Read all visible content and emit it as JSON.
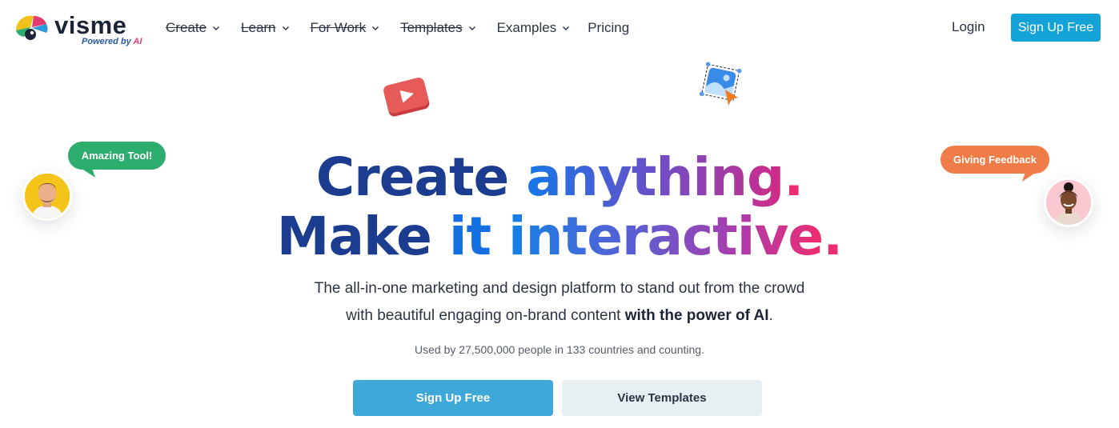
{
  "brand": {
    "name": "visme",
    "tagline_prefix": "Powered by",
    "tagline_ai": "AI"
  },
  "nav": {
    "items": [
      {
        "label": "Create",
        "dropdown": true,
        "struck": true
      },
      {
        "label": "Learn",
        "dropdown": true,
        "struck": true
      },
      {
        "label": "For Work",
        "dropdown": true,
        "struck": true
      },
      {
        "label": "Templates",
        "dropdown": true,
        "struck": true
      },
      {
        "label": "Examples",
        "dropdown": true,
        "struck": false
      },
      {
        "label": "Pricing",
        "dropdown": false,
        "struck": false
      }
    ],
    "login": "Login",
    "signup": "Sign Up Free"
  },
  "hero": {
    "line1_a": "Create",
    "line1_b": "anything",
    "line1_dot": ".",
    "line2_a": "Make",
    "line2_b": "it",
    "line2_c": "interactive",
    "line2_dot": ".",
    "sub1": "The all-in-one marketing and design platform to stand out from the crowd",
    "sub2_plain": "with beautiful engaging on-brand content",
    "sub2_bold": "with the power of AI",
    "sub2_end": ".",
    "used_by": "Used by 27,500,000 people in 133 countries and counting.",
    "cta_primary": "Sign Up Free",
    "cta_secondary": "View Templates"
  },
  "bubbles": {
    "left": "Amazing Tool!",
    "right": "Giving Feedback"
  },
  "colors": {
    "accent": "#13a3d6",
    "cta": "#3ea8d9",
    "navy": "#1b3c8f",
    "pink": "#ec2d74",
    "green_bubble": "#2dad6d",
    "orange_bubble": "#f07c48"
  },
  "icons": [
    "visme-logo-icon",
    "chevron-down-icon",
    "play-button-icon",
    "image-cursor-icon",
    "avatar-male",
    "avatar-female"
  ]
}
